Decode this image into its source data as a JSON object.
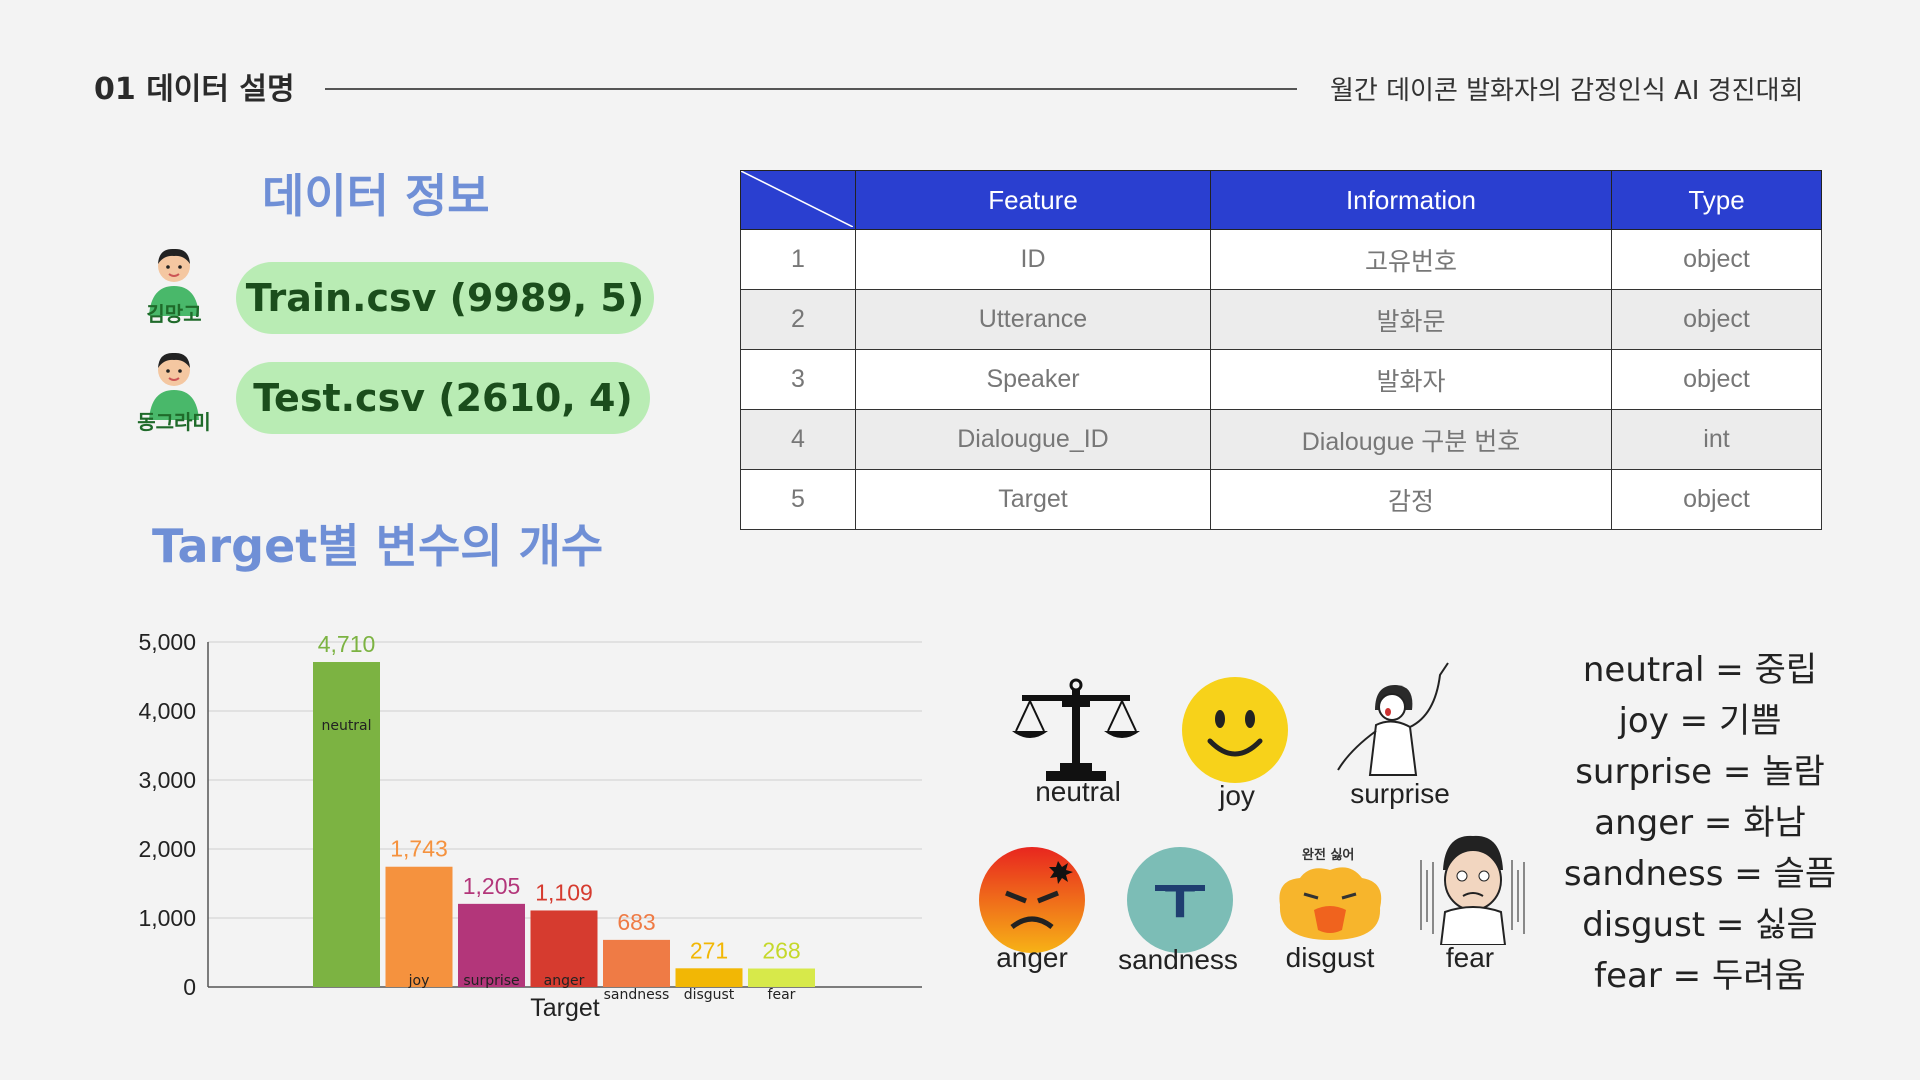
{
  "header": {
    "left": "01 데이터 설명",
    "right": "월간 데이콘 발화자의 감정인식 AI 경진대회"
  },
  "sections": {
    "info_title": "데이터 정보",
    "count_title": "Target별 변수의 개수"
  },
  "people": [
    {
      "name": "김망고",
      "file": "Train.csv  (9989, 5)"
    },
    {
      "name": "동그라미",
      "file": "Test.csv   (2610, 4)"
    }
  ],
  "table": {
    "headers": [
      "",
      "Feature",
      "Information",
      "Type"
    ],
    "rows": [
      [
        "1",
        "ID",
        "고유번호",
        "object"
      ],
      [
        "2",
        "Utterance",
        "발화문",
        "object"
      ],
      [
        "3",
        "Speaker",
        "발화자",
        "object"
      ],
      [
        "4",
        "Dialougue_ID",
        "Dialougue 구분 번호",
        "int"
      ],
      [
        "5",
        "Target",
        "감정",
        "object"
      ]
    ],
    "colors": {
      "header_bg": "#2a3fd0"
    }
  },
  "chart_data": {
    "type": "bar",
    "categories": [
      "neutral",
      "joy",
      "surprise",
      "anger",
      "sandness",
      "disgust",
      "fear"
    ],
    "values": [
      4710,
      1743,
      1205,
      1109,
      683,
      271,
      268
    ],
    "value_labels": [
      "4,710",
      "1,743",
      "1,205",
      "1,109",
      "683",
      "271",
      "268"
    ],
    "y_ticks": [
      "0",
      "1,000",
      "2,000",
      "3,000",
      "4,000",
      "5,000"
    ],
    "ylim": [
      0,
      5000
    ],
    "xlabel": "Target",
    "ylabel": "",
    "grid": true,
    "bar_colors": [
      "#7cb342",
      "#f5923e",
      "#b3367a",
      "#d63b2f",
      "#ef7b45",
      "#f2b705",
      "#d7e94a"
    ],
    "label_colors": [
      "#7cb342",
      "#f5923e",
      "#b3367a",
      "#d63b2f",
      "#ef7b45",
      "#f2b705",
      "#c5d82a"
    ]
  },
  "emotions": {
    "labels": [
      "neutral",
      "joy",
      "surprise",
      "anger",
      "sandness",
      "disgust",
      "fear"
    ],
    "disgust_caption": "완전 싫어",
    "icons": [
      "scale-icon",
      "smiley-icon",
      "surprise-person-icon",
      "angry-face-icon",
      "sad-teal-face-icon",
      "disgust-blob-icon",
      "fear-person-icon"
    ]
  },
  "mapping": [
    "neutral = 중립",
    "joy = 기쁨",
    "surprise = 놀람",
    "anger = 화남",
    "sandness = 슬픔",
    "disgust = 싫음",
    "fear = 두려움"
  ]
}
